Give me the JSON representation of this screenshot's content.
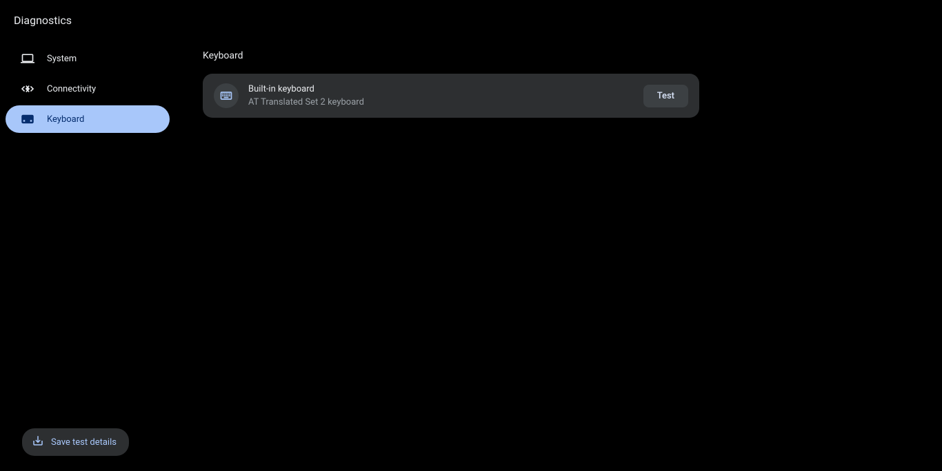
{
  "header": {
    "title": "Diagnostics"
  },
  "sidebar": {
    "items": [
      {
        "id": "system",
        "label": "System",
        "icon": "laptop-icon",
        "selected": false
      },
      {
        "id": "connectivity",
        "label": "Connectivity",
        "icon": "connectivity-icon",
        "selected": false
      },
      {
        "id": "keyboard",
        "label": "Keyboard",
        "icon": "keyboard-icon",
        "selected": true
      }
    ]
  },
  "main": {
    "section_title": "Keyboard",
    "device_card": {
      "icon": "keyboard-icon",
      "title": "Built-in keyboard",
      "subtitle": "AT Translated Set 2 keyboard",
      "action_label": "Test"
    }
  },
  "footer": {
    "save_label": "Save test details"
  }
}
